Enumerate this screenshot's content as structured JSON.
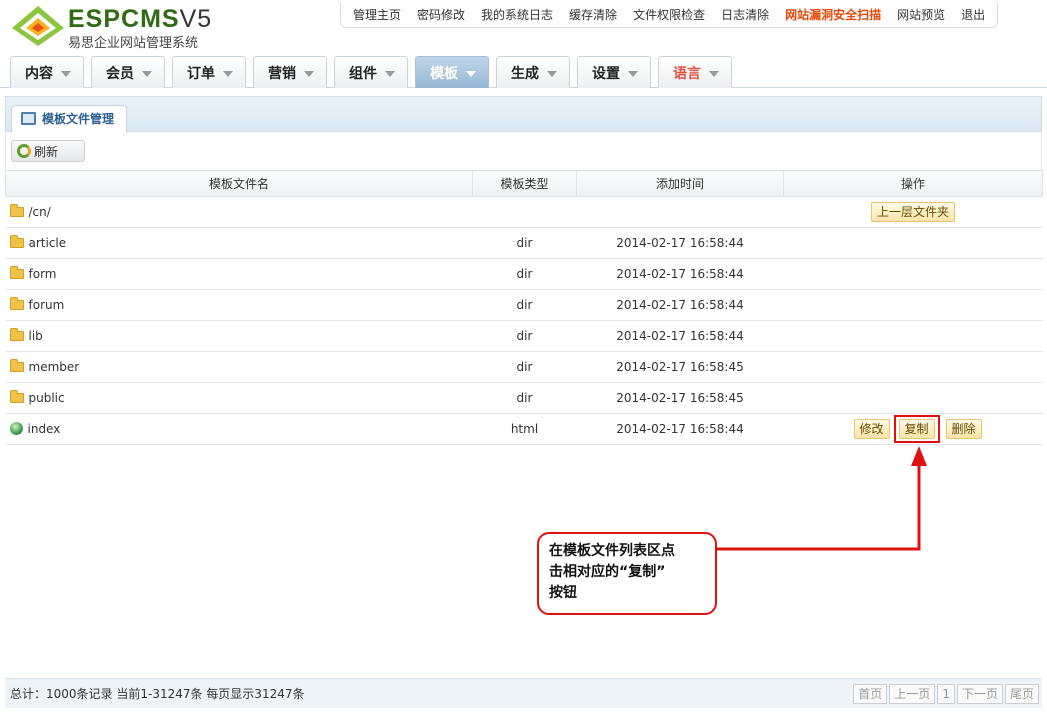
{
  "brand": {
    "name": "ESPCMS",
    "version": "V5",
    "tagline": "易思企业网站管理系统"
  },
  "topmenu": [
    "管理主页",
    "密码修改",
    "我的系统日志",
    "缓存清除",
    "文件权限检查",
    "日志清除",
    "网站漏洞安全扫描",
    "网站预览",
    "退出"
  ],
  "nav": [
    "内容",
    "会员",
    "订单",
    "营销",
    "组件",
    "模板",
    "生成",
    "设置",
    "语言"
  ],
  "panel": {
    "tab": "模板文件管理",
    "refresh": "刷新"
  },
  "table": {
    "headers": [
      "模板文件名",
      "模板类型",
      "添加时间",
      "操作"
    ],
    "up_row": {
      "name": "/cn/",
      "action": "上一层文件夹"
    },
    "rows": [
      {
        "name": "article",
        "type": "dir",
        "time": "2014-02-17 16:58:44"
      },
      {
        "name": "form",
        "type": "dir",
        "time": "2014-02-17 16:58:44"
      },
      {
        "name": "forum",
        "type": "dir",
        "time": "2014-02-17 16:58:44"
      },
      {
        "name": "lib",
        "type": "dir",
        "time": "2014-02-17 16:58:44"
      },
      {
        "name": "member",
        "type": "dir",
        "time": "2014-02-17 16:58:45"
      },
      {
        "name": "public",
        "type": "dir",
        "time": "2014-02-17 16:58:45"
      },
      {
        "name": "index",
        "type": "html",
        "time": "2014-02-17 16:58:44"
      }
    ],
    "actions": {
      "edit": "修改",
      "copy": "复制",
      "delete": "删除"
    }
  },
  "callout": {
    "line1": "在模板文件列表区点",
    "line2": "击相对应的“复制”",
    "line3": "按钮"
  },
  "footer": {
    "summary": "总计：1000条记录 当前1-31247条 每页显示31247条",
    "pager": [
      "首页",
      "上一页",
      "1",
      "下一页",
      "尾页"
    ]
  },
  "colors": {
    "accent_red": "#e01010",
    "nav_active": "#97b7d3",
    "brand_green": "#2e6b14"
  },
  "icons": {
    "logo": "espcms-logo",
    "refresh": "refresh-icon",
    "folder": "folder-icon",
    "file": "html-file-icon"
  }
}
